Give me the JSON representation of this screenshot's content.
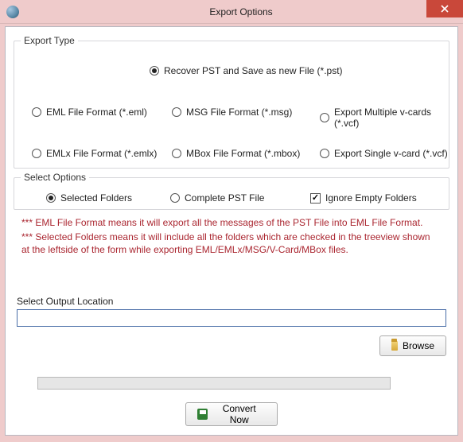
{
  "window": {
    "title": "Export Options"
  },
  "exportType": {
    "legend": "Export Type",
    "options": {
      "recoverPst": "Recover PST and Save as new File (*.pst)",
      "eml": "EML File  Format (*.eml)",
      "msg": "MSG File Format (*.msg)",
      "vcfMulti": "Export Multiple v-cards (*.vcf)",
      "emlx": "EMLx File  Format (*.emlx)",
      "mbox": "MBox File Format (*.mbox)",
      "vcfSingle": "Export Single v-card (*.vcf)"
    },
    "selected": "recoverPst"
  },
  "selectOptions": {
    "legend": "Select Options",
    "radios": {
      "selectedFolders": "Selected Folders",
      "completePst": "Complete PST File"
    },
    "selectedRadio": "selectedFolders",
    "ignoreEmpty": {
      "label": "Ignore Empty Folders",
      "checked": true
    }
  },
  "notes": {
    "line1": "*** EML File Format means it will export all the messages of the PST File into EML File Format.",
    "line2": "*** Selected Folders means it will include all the folders which are checked in the treeview shown at the leftside of the form while exporting EML/EMLx/MSG/V-Card/MBox files."
  },
  "output": {
    "label": "Select Output Location",
    "value": ""
  },
  "buttons": {
    "browse": "Browse",
    "convert": "Convert Now"
  }
}
